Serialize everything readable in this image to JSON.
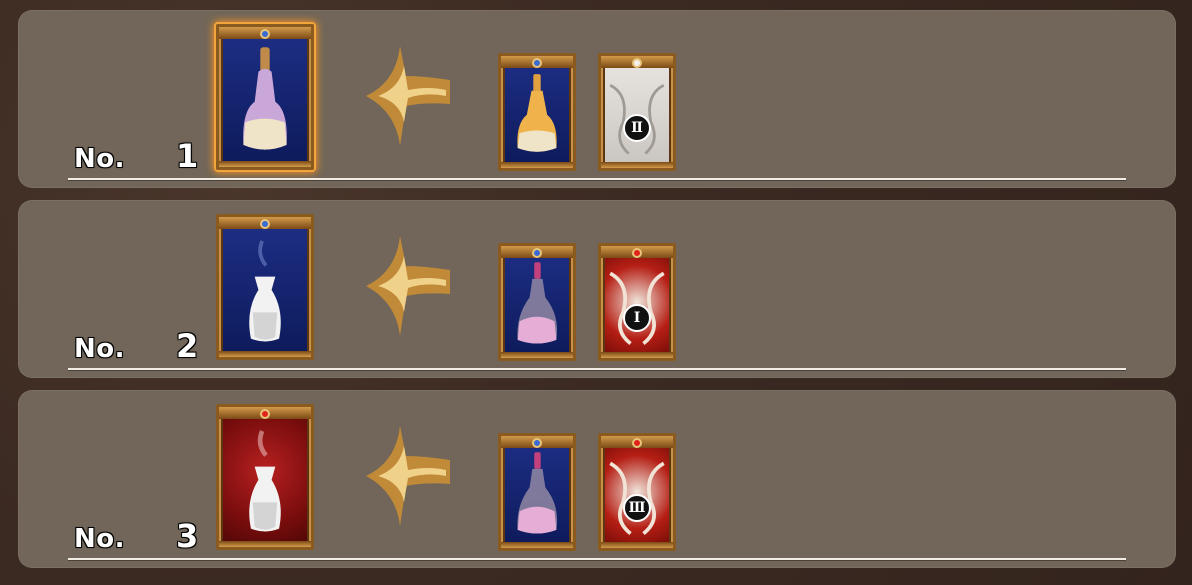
{
  "rows": [
    {
      "label": "No.",
      "number": "1",
      "result": {
        "icon": "purple-bottle-icon",
        "frame": "blue",
        "selected": true
      },
      "ingredients": [
        {
          "icon": "gold-bottle-icon",
          "frame": "blue"
        },
        {
          "icon": "white-crest-rank-ii-icon",
          "frame": "white",
          "rank": "Ⅱ"
        }
      ]
    },
    {
      "label": "No.",
      "number": "2",
      "result": {
        "icon": "white-vase-icon",
        "frame": "blue",
        "selected": false
      },
      "ingredients": [
        {
          "icon": "pink-flask-icon",
          "frame": "blue"
        },
        {
          "icon": "red-crest-rank-i-icon",
          "frame": "red",
          "rank": "Ⅰ"
        }
      ]
    },
    {
      "label": "No.",
      "number": "3",
      "result": {
        "icon": "white-vase-smoke-icon",
        "frame": "red",
        "selected": false
      },
      "ingredients": [
        {
          "icon": "pink-flask-icon",
          "frame": "blue"
        },
        {
          "icon": "red-crest-rank-iii-icon",
          "frame": "red",
          "rank": "Ⅲ"
        }
      ]
    }
  ]
}
